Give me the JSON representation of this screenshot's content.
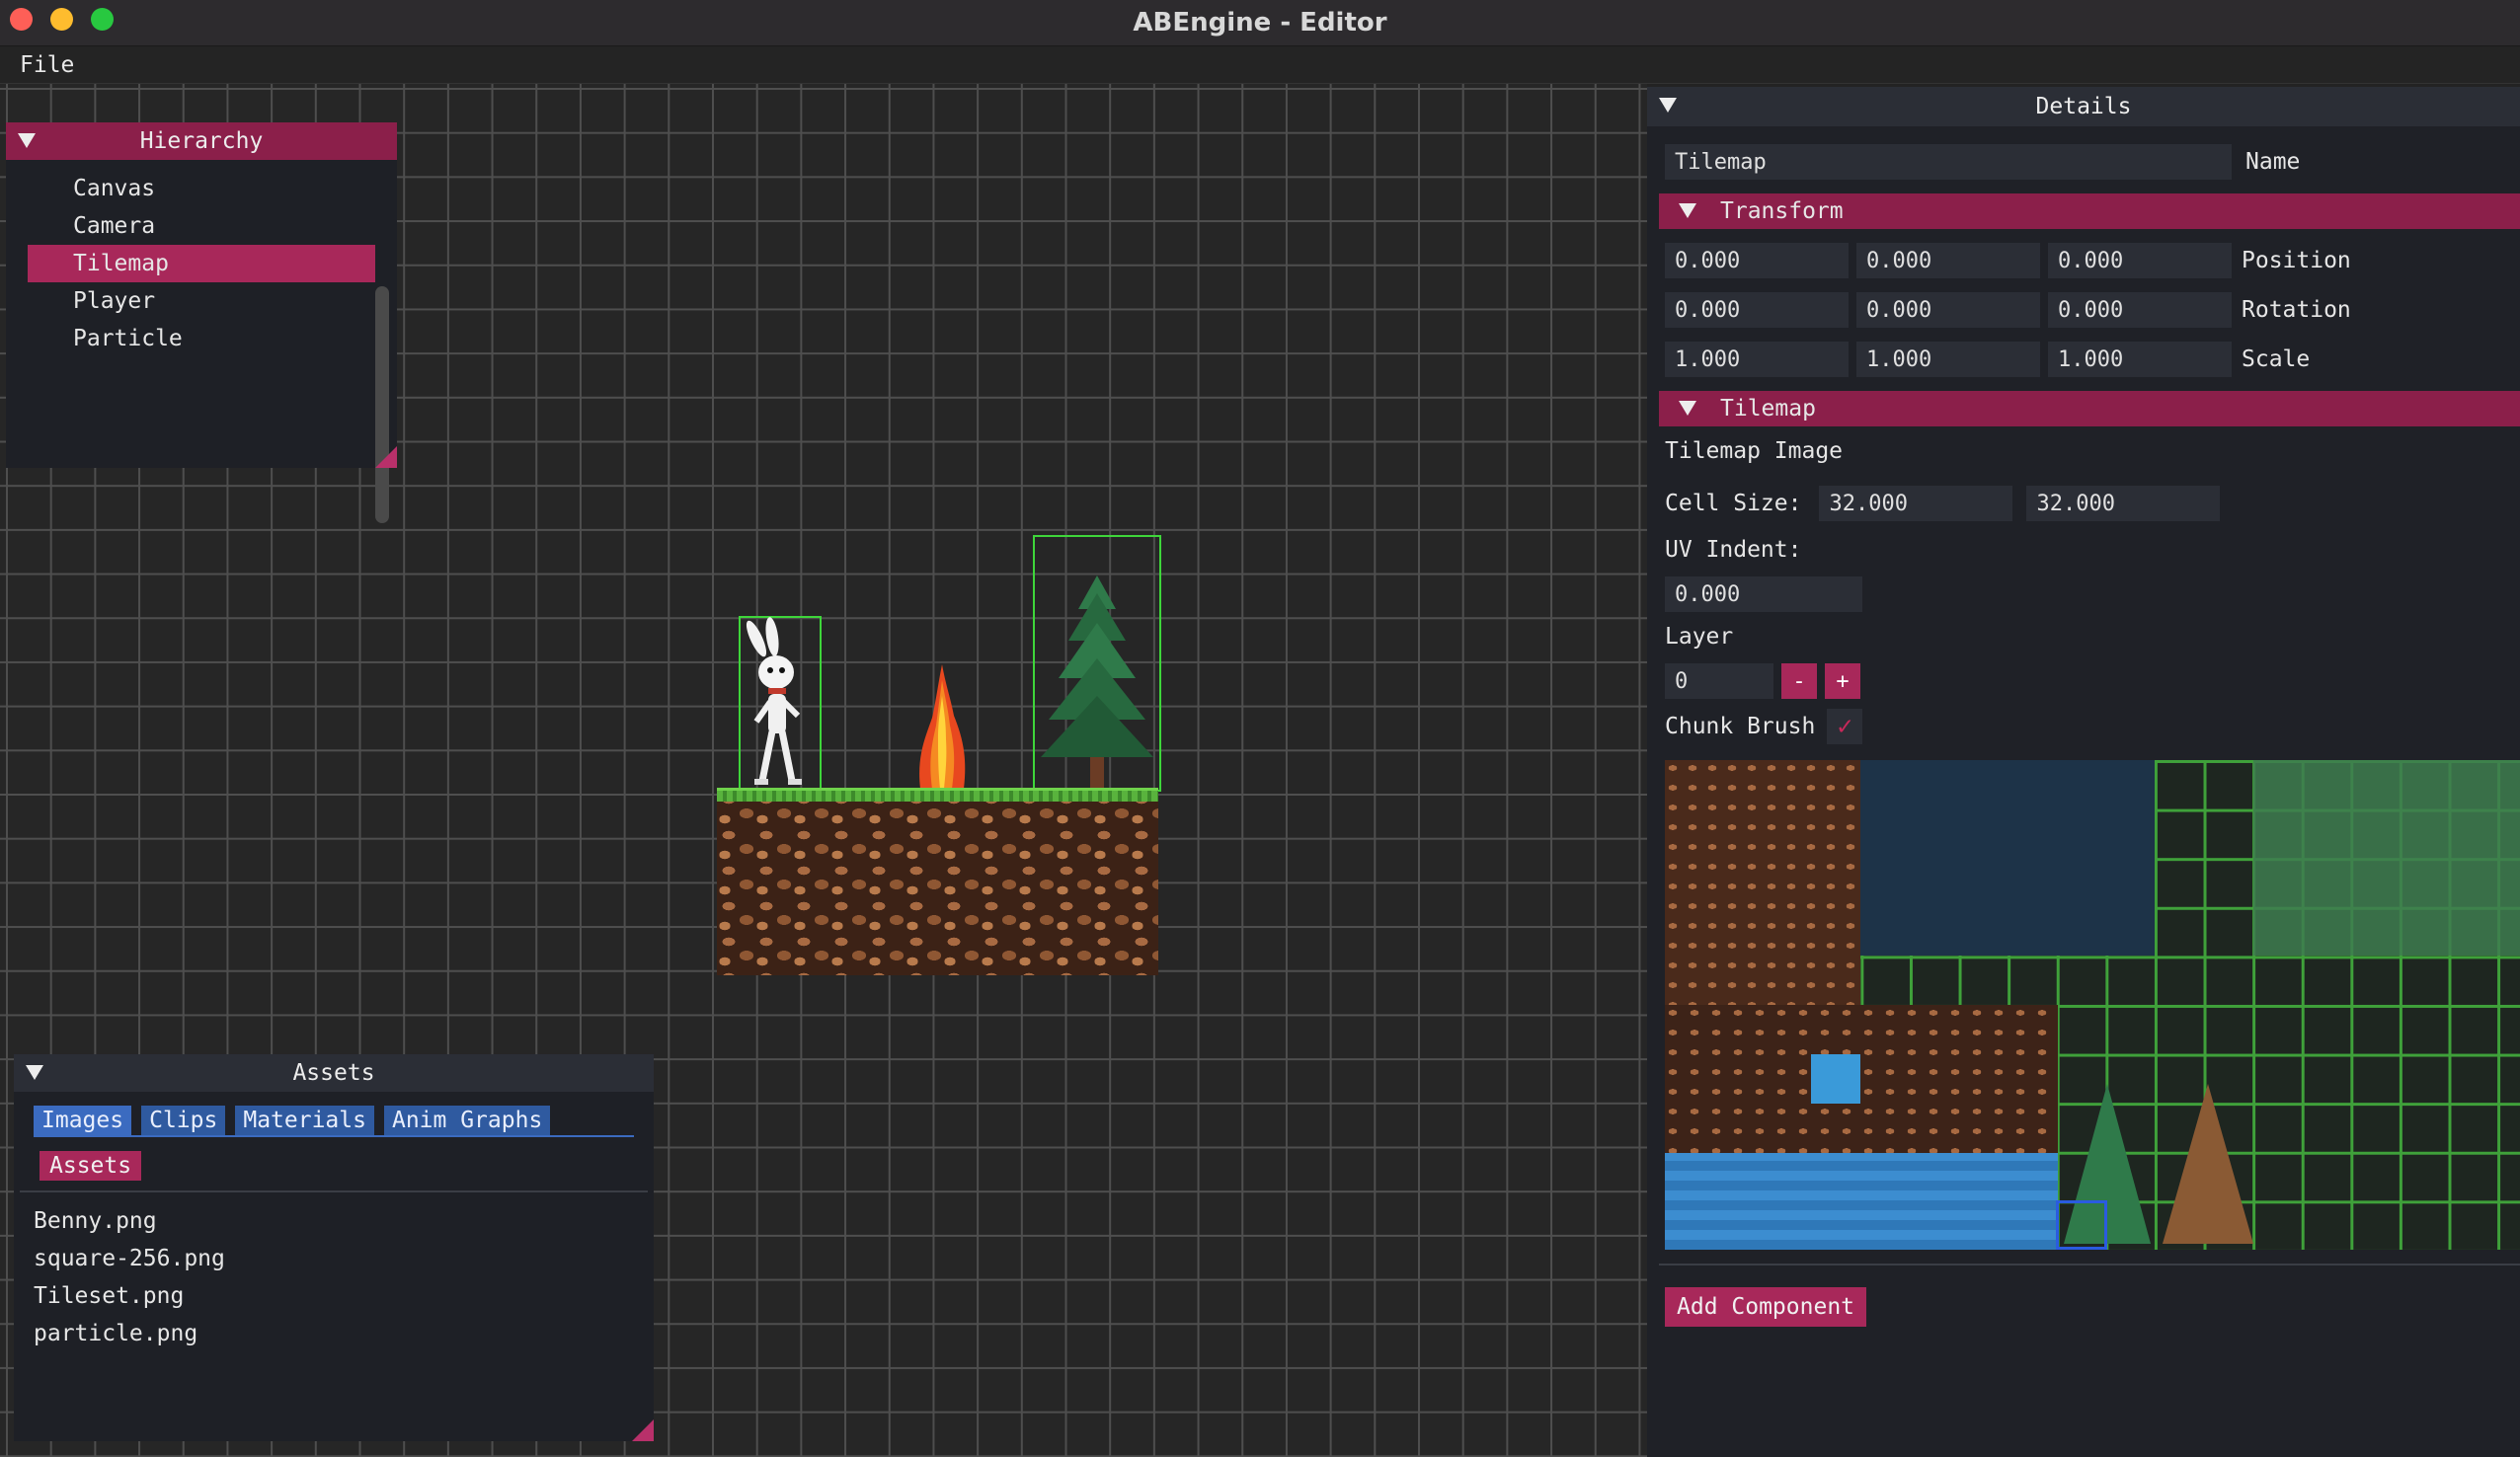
{
  "window": {
    "title": "ABEngine - Editor"
  },
  "menu": {
    "items": [
      "File"
    ]
  },
  "hierarchy": {
    "title": "Hierarchy",
    "items": [
      "Canvas",
      "Camera",
      "Tilemap",
      "Player",
      "Particle"
    ],
    "selected_index": 2
  },
  "assets": {
    "title": "Assets",
    "tabs": [
      "Images",
      "Clips",
      "Materials",
      "Anim Graphs"
    ],
    "breadcrumb": "Assets",
    "files": [
      "Benny.png",
      "square-256.png",
      "Tileset.png",
      "particle.png"
    ]
  },
  "details": {
    "title": "Details",
    "name_value": "Tilemap",
    "name_label": "Name",
    "transform": {
      "header": "Transform",
      "position": {
        "x": "0.000",
        "y": "0.000",
        "z": "0.000",
        "label": "Position"
      },
      "rotation": {
        "x": "0.000",
        "y": "0.000",
        "z": "0.000",
        "label": "Rotation"
      },
      "scale": {
        "x": "1.000",
        "y": "1.000",
        "z": "1.000",
        "label": "Scale"
      }
    },
    "tilemap": {
      "header": "Tilemap",
      "image_label": "Tilemap Image",
      "cell_size_label": "Cell Size:",
      "cell_size_x": "32.000",
      "cell_size_y": "32.000",
      "uv_indent_label": "UV Indent:",
      "uv_indent": "0.000",
      "layer_label": "Layer",
      "layer_value": "0",
      "minus_label": "-",
      "plus_label": "+",
      "chunk_brush_label": "Chunk Brush",
      "chunk_brush_checked": true
    },
    "add_component_label": "Add Component"
  },
  "colors": {
    "accent": "#a8285a",
    "header_accent": "#8b1f4a",
    "tab_blue": "#2f5aa0",
    "selection_green": "#3ed63a"
  }
}
